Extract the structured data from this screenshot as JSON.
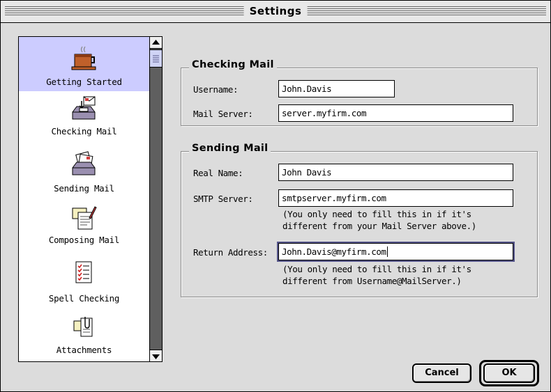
{
  "window": {
    "title": "Settings"
  },
  "sidebar": {
    "items": [
      {
        "label": "Getting Started",
        "icon": "coffee-cup-icon",
        "selected": true
      },
      {
        "label": "Checking Mail",
        "icon": "mail-inbox-icon",
        "selected": false
      },
      {
        "label": "Sending Mail",
        "icon": "mail-outbox-icon",
        "selected": false
      },
      {
        "label": "Composing Mail",
        "icon": "compose-document-icon",
        "selected": false
      },
      {
        "label": "Spell Checking",
        "icon": "checklist-icon",
        "selected": false
      },
      {
        "label": "Attachments",
        "icon": "attachment-icon",
        "selected": false
      }
    ]
  },
  "checking_mail": {
    "title": "Checking Mail",
    "username_label": "Username:",
    "username_value": "John.Davis",
    "server_label": "Mail Server:",
    "server_value": "server.myfirm.com"
  },
  "sending_mail": {
    "title": "Sending Mail",
    "real_name_label": "Real Name:",
    "real_name_value": "John Davis",
    "smtp_label": "SMTP Server:",
    "smtp_value": "smtpserver.myfirm.com",
    "smtp_note_line1": "(You only need to fill this in if it's",
    "smtp_note_line2": "different from your Mail Server above.)",
    "return_label": "Return Address:",
    "return_value": "John.Davis@myfirm.com",
    "return_note_line1": "(You only need to fill this in if it's",
    "return_note_line2": "different from Username@MailServer.)"
  },
  "buttons": {
    "cancel": "Cancel",
    "ok": "OK"
  },
  "colors": {
    "selection": "#ccccff",
    "window_bg": "#dcdcdc",
    "scroll_track": "#5f5f5f"
  }
}
